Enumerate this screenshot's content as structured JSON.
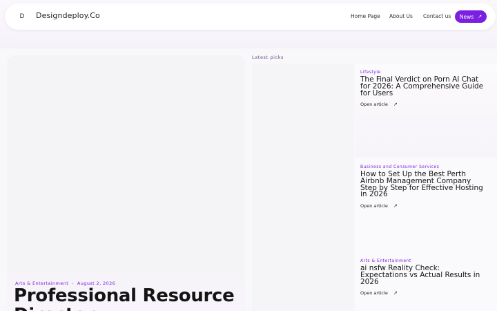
{
  "header": {
    "logo_letter": "D",
    "brand": "Designdeploy.Co",
    "nav": [
      {
        "label": "Home Page"
      },
      {
        "label": "About Us"
      },
      {
        "label": "Contact us"
      }
    ],
    "cta_label": "News",
    "cta_icon": "arrow-up-right-icon"
  },
  "featured": {
    "category": "Arts & Entertainment",
    "separator": "-",
    "date": "August 2, 2026",
    "title": "Professional Resource Directory"
  },
  "latest": {
    "label": "Latest picks",
    "items": [
      {
        "category": "Lifestyle",
        "title": "The Final Verdict on Porn AI Chat for 2026: A Comprehensive Guide for Users",
        "link": "Open article"
      },
      {
        "category": "Business and Consumer Services",
        "title": "How to Set Up the Best Perth Airbnb Management Company Step by Step for Effective Hosting in 2026",
        "link": "Open article"
      },
      {
        "category": "Arts & Entertainment",
        "title": "ai nsfw Reality Check: Expectations vs Actual Results in 2026",
        "link": "Open article"
      }
    ]
  },
  "colors": {
    "accent": "#7b1fe0",
    "background": "#f8f7fa"
  }
}
